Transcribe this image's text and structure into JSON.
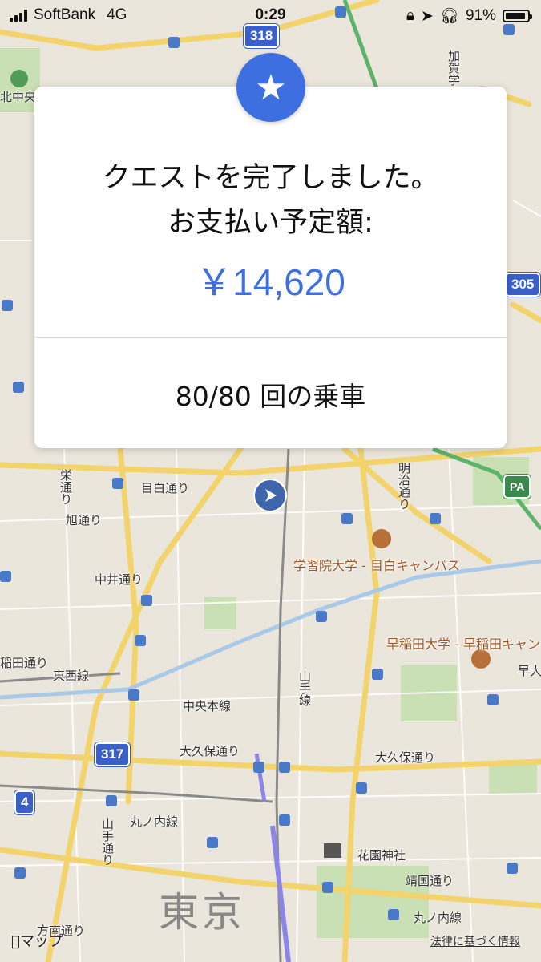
{
  "status_bar": {
    "carrier": "SoftBank",
    "network": "4G",
    "time": "0:29",
    "battery_percent": "91%",
    "battery_level": 0.91
  },
  "quest_card": {
    "title_line1": "クエストを完了しました。",
    "title_line2": "お支払い予定額:",
    "amount": "￥14,620",
    "rides": "80/80 回の乗車",
    "accent_color": "#3d6fe0",
    "badge_icon": "star-icon"
  },
  "map": {
    "labels": {
      "mejiro_dori": "目白通り",
      "sakae_dori": "栄通り",
      "asahi_dori": "旭通り",
      "nakai_dori": "中井通り",
      "meiji_dori": "明治通り",
      "gakushuin": "学習院大学 - 目白キャンパス",
      "waseda": "早稲田大学 - 早稲田キャン",
      "tozai_line": "東西線",
      "chuo_line": "中央本線",
      "yamanote_line": "山手線",
      "okubo_dori": "大久保通り",
      "okubo_dori2": "大久保通り",
      "marunouchi_line": "丸ノ内線",
      "marunouchi_line2": "丸ノ内線",
      "yamate_dori": "山手通り",
      "hanazono": "花園神社",
      "yasukuni_dori": "靖国通り",
      "honan_dori": "方南通り",
      "takadanobaba_dori": "稲田通り",
      "kita_chuo": "北中央",
      "kaga": "加賀学園",
      "hayabusa": "早大",
      "shinjuku": "東京"
    },
    "route_shields": {
      "r318": "318",
      "r305": "305",
      "r317": "317",
      "r4": "4",
      "pa": "PA"
    }
  },
  "footer": {
    "maps_logo": "マップ",
    "legal": "法律に基づく情報"
  }
}
